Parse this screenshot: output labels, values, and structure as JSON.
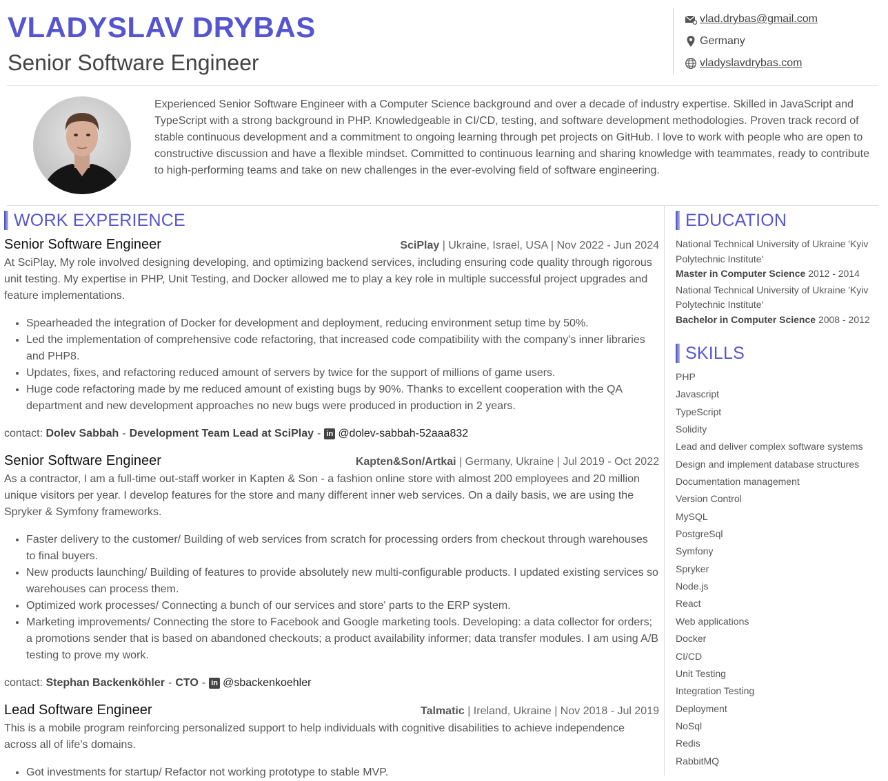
{
  "header": {
    "name": "VLADYSLAV DRYBAS",
    "title": "Senior Software Engineer",
    "email": "vlad.drybas@gmail.com",
    "location": "Germany",
    "website": "vladyslavdrybas.com"
  },
  "summary": "Experienced Senior Software Engineer with a Computer Science background and over a decade of industry expertise. Skilled in JavaScript and TypeScript with a strong background in PHP. Knowledgeable in CI/CD, testing, and software development methodologies. Proven track record of stable continuous development and a commitment to ongoing learning through pet projects on GitHub. I love to work with people who are open to constructive discussion and have a flexible mindset. Committed to continuous learning and sharing knowledge with teammates, ready to contribute to high-performing teams and take on new challenges in the ever-evolving field of software engineering.",
  "work": {
    "title": "WORK EXPERIENCE",
    "jobs": [
      {
        "role": "Senior Software Engineer",
        "company": "SciPlay",
        "details": "| Ukraine, Israel, USA | Nov 2022 - Jun 2024",
        "description": "At SciPlay, My role involved designing developing, and optimizing backend services, including ensuring code quality through rigorous unit testing. My expertise in PHP, Unit Testing, and Docker allowed me to play a key role in multiple successful project upgrades and feature implementations.",
        "bullets": [
          "Spearheaded the integration of Docker for development and deployment, reducing environment setup time by 50%.",
          "Led the implementation of comprehensive code refactoring, that increased code compatibility with the company's inner libraries and PHP8.",
          "Updates, fixes, and refactoring reduced amount of servers by twice for the support of millions of game users.",
          "Huge code refactoring made by me reduced amount of existing bugs by 90%. Thanks to excellent cooperation with the QA department and new development approaches no new bugs were produced in production in 2 years."
        ],
        "contact_label": "contact:",
        "contact_name": "Dolev Sabbah",
        "contact_role": "Development Team Lead at SciPlay",
        "contact_handle": "@dolev-sabbah-52aaa832"
      },
      {
        "role": "Senior Software Engineer",
        "company": "Kapten&Son/Artkai",
        "details": "| Germany, Ukraine | Jul 2019 - Oct 2022",
        "description": "As a contractor, I am a full-time out-staff worker in Kapten & Son - a fashion online store with almost 200 employees and 20 million unique visitors per year. I develop features for the store and many different inner web services. On a daily basis, we are using the Spryker & Symfony frameworks.",
        "bullets": [
          "Faster delivery to the customer/ Building of web services from scratch for processing orders from checkout through warehouses to final buyers.",
          "New products launching/ Building of features to provide absolutely new multi-configurable products. I updated existing services so warehouses can process them.",
          "Optimized work processes/ Connecting a bunch of our services and store' parts to the ERP system.",
          "Marketing improvements/ Connecting the store to Facebook and Google marketing tools. Developing: a data collector for orders; a promotions sender that is based on abandoned checkouts; a product availability informer; data transfer modules. I am using A/B testing to prove my work."
        ],
        "contact_label": "contact:",
        "contact_name": "Stephan Backenköhler",
        "contact_role": "CTO",
        "contact_handle": "@sbackenkoehler"
      },
      {
        "role": "Lead Software Engineer",
        "company": "Talmatic",
        "details": "| Ireland, Ukraine | Nov 2018 - Jul 2019",
        "description": "This is a mobile program reinforcing personalized support to help individuals with cognitive disabilities to achieve independence across all of life’s domains.",
        "bullets": [
          "Got investments for startup/ Refactor not working prototype to stable MVP."
        ]
      }
    ]
  },
  "education": {
    "title": "EDUCATION",
    "items": [
      {
        "school": "National Technical University of Ukraine 'Kyiv Polytechnic Institute'",
        "degree": "Master in Computer Science",
        "years": "2012 - 2014"
      },
      {
        "school": "National Technical University of Ukraine 'Kyiv Polytechnic Institute'",
        "degree": "Bachelor in Computer Science",
        "years": "2008 - 2012"
      }
    ]
  },
  "skills": {
    "title": "SKILLS",
    "items": [
      "PHP",
      "Javascript",
      "TypeScript",
      "Solidity",
      "Lead and deliver complex software systems",
      "Design and implement database structures",
      "Documentation management",
      "Version Control",
      "MySQL",
      "PostgreSql",
      "Symfony",
      "Spryker",
      "Node.js",
      "React",
      "Web applications",
      "Docker",
      "CI/CD",
      "Unit Testing",
      "Integration Testing",
      "Deployment",
      "NoSql",
      "Redis",
      "RabbitMQ"
    ]
  },
  "icons": {
    "email": "envelope-icon",
    "location": "map-pin-icon",
    "website": "globe-icon",
    "linkedin": "linkedin-icon"
  },
  "colors": {
    "accent": "#5555d0"
  }
}
